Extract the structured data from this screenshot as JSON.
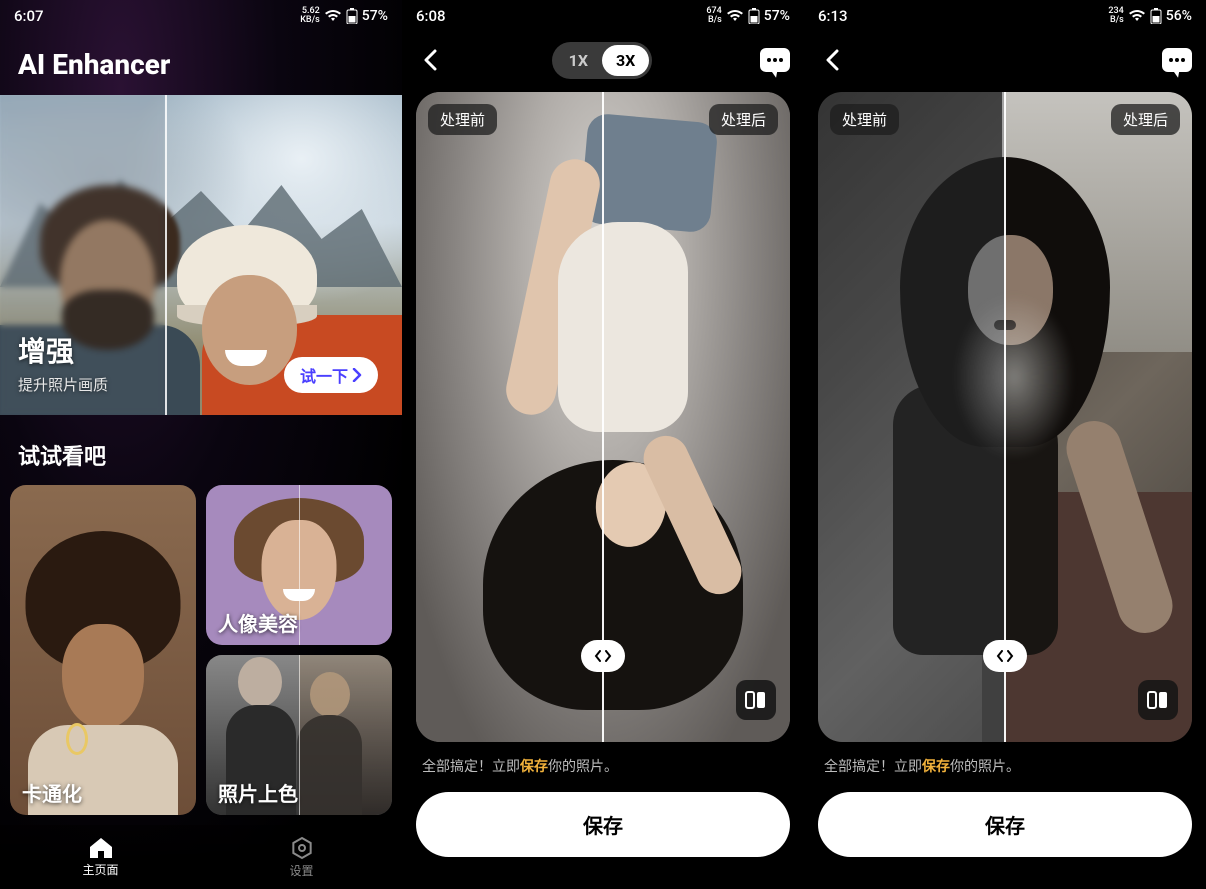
{
  "screens": [
    {
      "status": {
        "time": "6:07",
        "speed_top": "5.62",
        "speed_bot": "KB/s",
        "battery": "57%"
      },
      "app_title": "AI Enhancer",
      "hero": {
        "title": "增强",
        "subtitle": "提升照片画质",
        "cta": "试一下"
      },
      "section_title": "试试看吧",
      "tiles": [
        {
          "label": "卡通化"
        },
        {
          "label": "人像美容"
        },
        {
          "label": "照片上色"
        }
      ],
      "nav": {
        "home": "主页面",
        "settings": "设置"
      }
    },
    {
      "status": {
        "time": "6:08",
        "speed_top": "674",
        "speed_bot": "B/s",
        "battery": "57%"
      },
      "zoom": {
        "x1": "1X",
        "x3": "3X"
      },
      "tags": {
        "before": "处理前",
        "after": "处理后"
      },
      "done_prefix": "全部搞定！立即",
      "done_hl": "保存",
      "done_suffix": "你的照片。",
      "save": "保存"
    },
    {
      "status": {
        "time": "6:13",
        "speed_top": "234",
        "speed_bot": "B/s",
        "battery": "56%"
      },
      "tags": {
        "before": "处理前",
        "after": "处理后"
      },
      "done_prefix": "全部搞定！立即",
      "done_hl": "保存",
      "done_suffix": "你的照片。",
      "save": "保存"
    }
  ]
}
